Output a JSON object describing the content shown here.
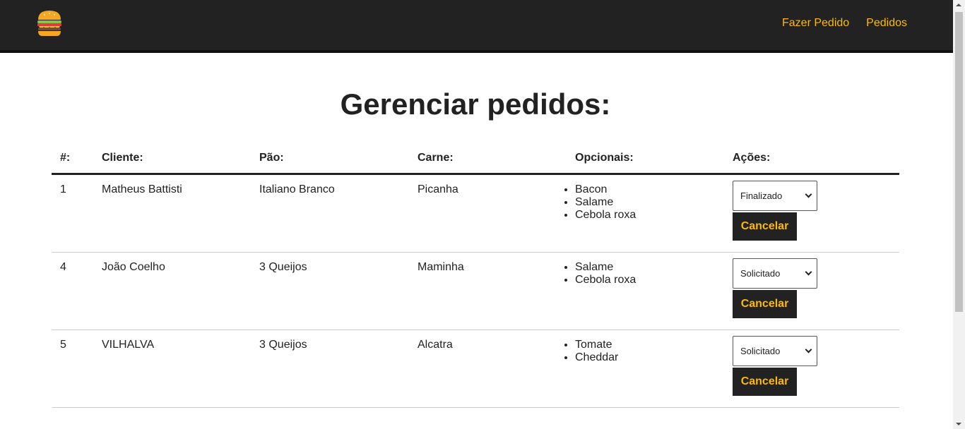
{
  "nav": {
    "logo_icon": "burger-icon",
    "links": [
      "Fazer Pedido",
      "Pedidos"
    ]
  },
  "page": {
    "title": "Gerenciar pedidos:"
  },
  "table": {
    "headers": [
      "#:",
      "Cliente:",
      "Pão:",
      "Carne:",
      "Opcionais:",
      "Ações:"
    ],
    "rows": [
      {
        "id": "1",
        "cliente": "Matheus Battisti",
        "pao": "Italiano Branco",
        "carne": "Picanha",
        "opcionais": [
          "Bacon",
          "Salame",
          "Cebola roxa"
        ],
        "status": "Finalizado",
        "cancel_label": "Cancelar"
      },
      {
        "id": "4",
        "cliente": "João Coelho",
        "pao": "3 Queijos",
        "carne": "Maminha",
        "opcionais": [
          "Salame",
          "Cebola roxa"
        ],
        "status": "Solicitado",
        "cancel_label": "Cancelar"
      },
      {
        "id": "5",
        "cliente": "VILHALVA",
        "pao": "3 Queijos",
        "carne": "Alcatra",
        "opcionais": [
          "Tomate",
          "Cheddar"
        ],
        "status": "Solicitado",
        "cancel_label": "Cancelar"
      }
    ]
  },
  "colors": {
    "navbar_bg": "#222222",
    "accent": "#fcba03",
    "button_bg": "#222222"
  }
}
